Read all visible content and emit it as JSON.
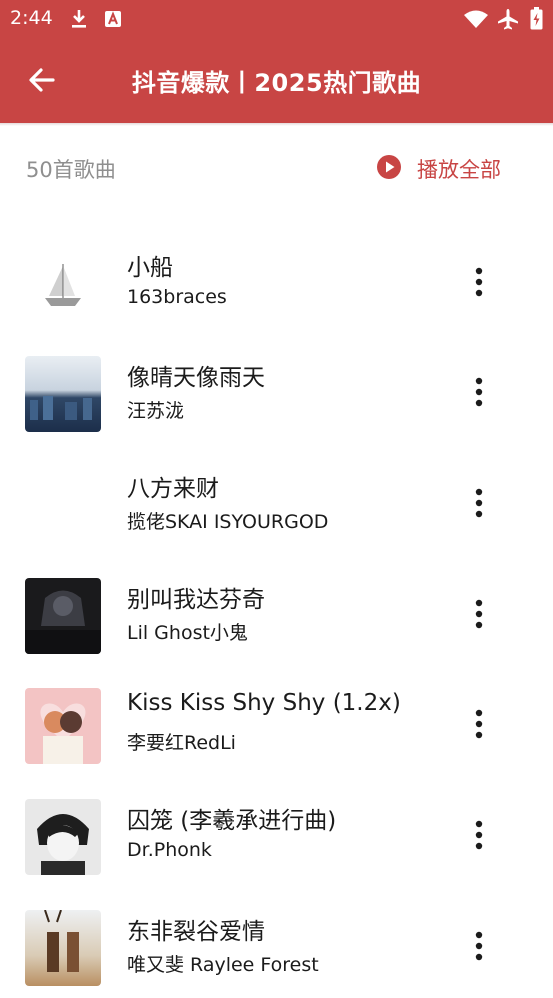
{
  "status_bar": {
    "time": "2:44",
    "icons": [
      "download-icon",
      "app-icon",
      "wifi-icon",
      "airplane-icon",
      "battery-icon"
    ]
  },
  "app_bar": {
    "back_icon": "back-arrow-icon",
    "title": "抖音爆款丨2025热门歌曲",
    "color": "#c84544"
  },
  "list_header": {
    "count_label": "50首歌曲",
    "play_all_label": "播放全部",
    "play_all_icon": "play-circle-icon"
  },
  "songs": [
    {
      "title": "小船",
      "artist": "163braces"
    },
    {
      "title": "像晴天像雨天",
      "artist": "汪苏泷"
    },
    {
      "title": "八方来财",
      "artist": "揽佬SKAI ISYOURGOD"
    },
    {
      "title": "别叫我达芬奇",
      "artist": "Lil Ghost小鬼"
    },
    {
      "title": "Kiss Kiss Shy Shy (1.2x)",
      "artist": "李要红RedLi"
    },
    {
      "title": "囚笼 (李羲承进行曲)",
      "artist": "Dr.Phonk"
    },
    {
      "title": "东非裂谷爱情",
      "artist": "唯又斐 Raylee Forest"
    }
  ]
}
